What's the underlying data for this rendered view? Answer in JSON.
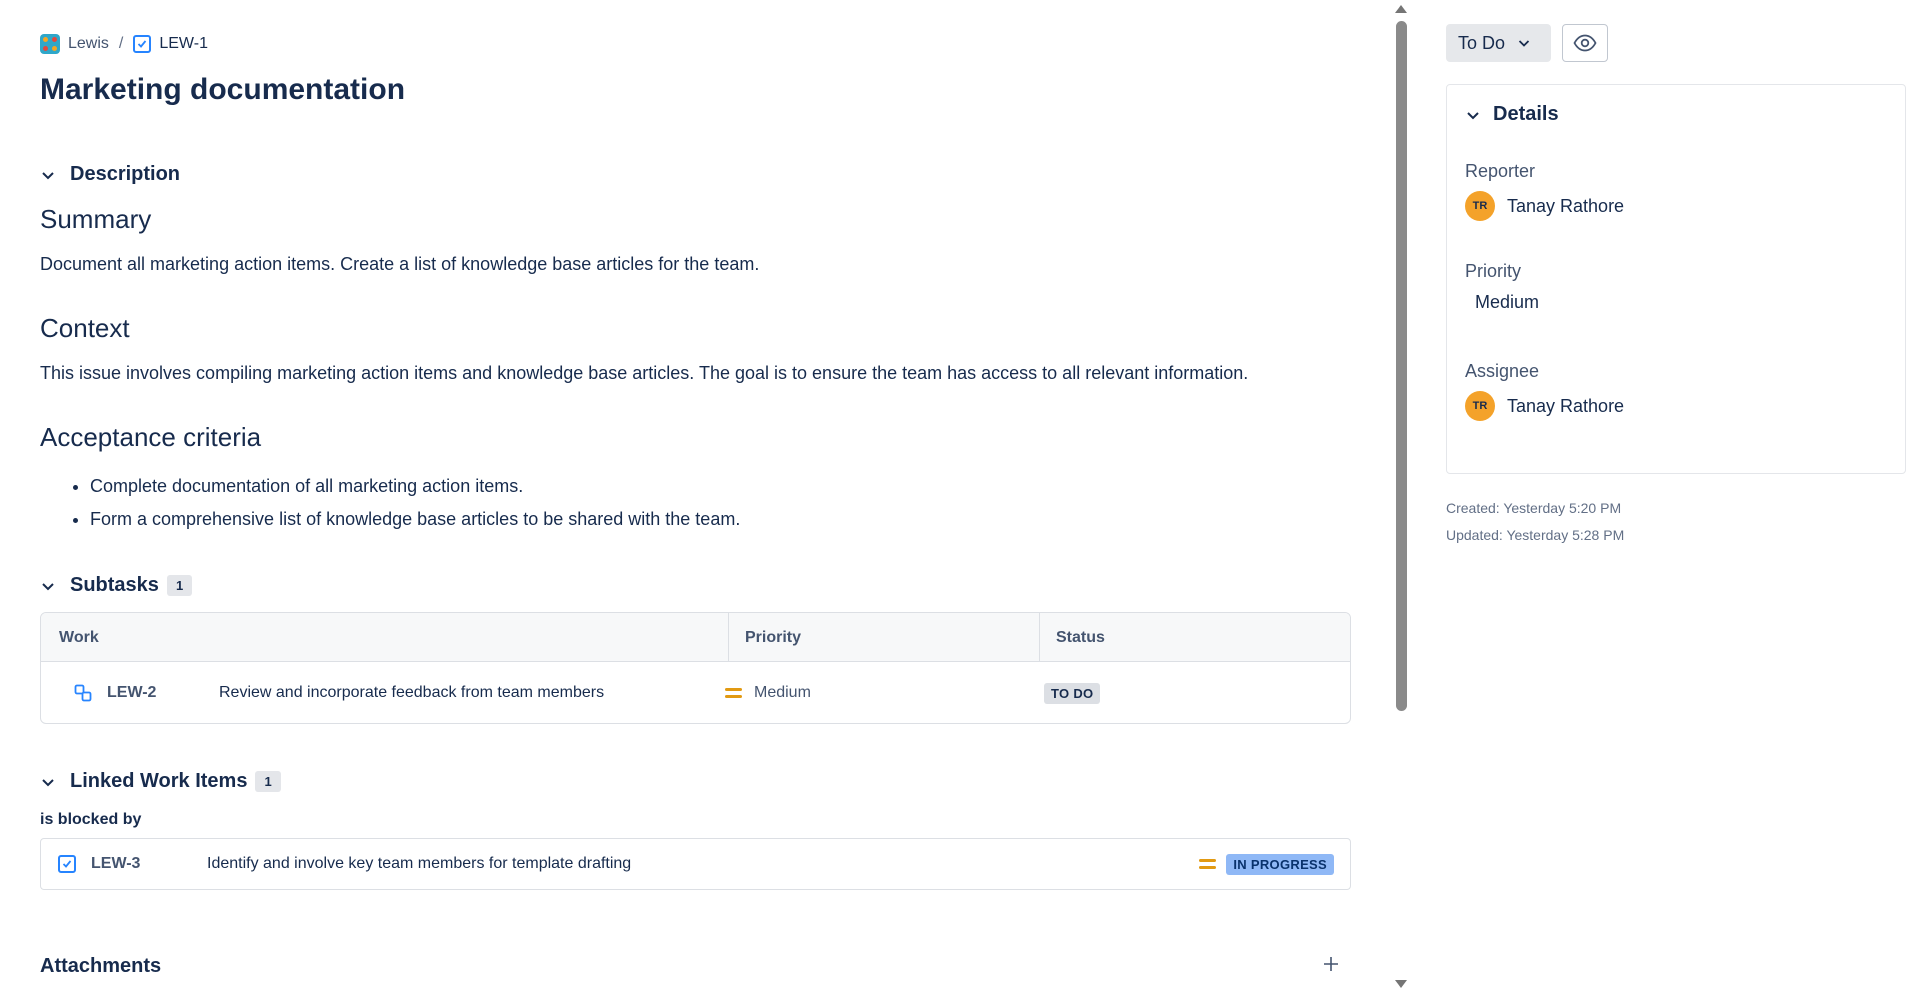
{
  "breadcrumb": {
    "project": "Lewis",
    "separator": "/",
    "issue_key": "LEW-1"
  },
  "issue": {
    "title": "Marketing documentation"
  },
  "description": {
    "heading": "Description",
    "summary_heading": "Summary",
    "summary_text": "Document all marketing action items. Create a list of knowledge base articles for the team.",
    "context_heading": "Context",
    "context_text": "This issue involves compiling marketing action items and knowledge base articles. The goal is to ensure the team has access to all relevant information.",
    "acceptance_heading": "Acceptance criteria",
    "acceptance_items": [
      "Complete documentation of all marketing action items.",
      "Form a comprehensive list of knowledge base articles to be shared with the team."
    ]
  },
  "subtasks": {
    "heading": "Subtasks",
    "count": "1",
    "columns": [
      "Work",
      "Priority",
      "Status"
    ],
    "rows": [
      {
        "key": "LEW-2",
        "summary": "Review and incorporate feedback from team members",
        "priority": "Medium",
        "status": "TO DO"
      }
    ]
  },
  "linked": {
    "heading": "Linked Work Items",
    "count": "1",
    "relation": "is blocked by",
    "items": [
      {
        "key": "LEW-3",
        "summary": "Identify and involve key team members for template drafting",
        "status": "IN PROGRESS"
      }
    ]
  },
  "attachments": {
    "heading": "Attachments"
  },
  "sidebar": {
    "status_button": "To Do",
    "details_heading": "Details",
    "reporter_label": "Reporter",
    "reporter_initials": "TR",
    "reporter_name": "Tanay Rathore",
    "priority_label": "Priority",
    "priority_value": "Medium",
    "assignee_label": "Assignee",
    "assignee_initials": "TR",
    "assignee_name": "Tanay Rathore",
    "created": "Created: Yesterday 5:20 PM",
    "updated": "Updated: Yesterday 5:28 PM"
  },
  "colors": {
    "text": "#172b4d",
    "priority_medium": "#e29a12",
    "avatar": "#f4a22a",
    "in_progress": "#8fb8f6",
    "todo": "#dcdfe4"
  }
}
